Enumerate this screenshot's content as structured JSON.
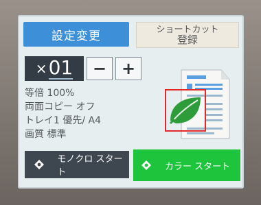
{
  "buttons": {
    "settings": "設定変更",
    "shortcut_line1": "ショートカット",
    "shortcut_line2": "登録",
    "minus": "−",
    "plus": "+",
    "mono_start": "モノクロ スタート",
    "color_start": "カラー スタート"
  },
  "copies": {
    "prefix": "×",
    "value": "01"
  },
  "settings_info": [
    "等倍 100%",
    "両面コピー オフ",
    "トレイ1 優先/ A4",
    "画質 標準"
  ],
  "icons": {
    "document": "document-preview-icon",
    "eco": "leaf-icon",
    "start": "start-diamond-icon"
  },
  "colors": {
    "accent_blue": "#3d8fd8",
    "start_green": "#1ec43c",
    "dark_panel": "#333b44",
    "eco_green": "#2e9c3a",
    "highlight_red": "#e02a2a"
  }
}
